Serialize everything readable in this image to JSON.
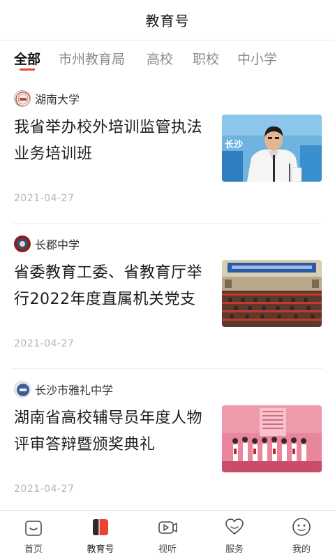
{
  "header": {
    "title": "教育号"
  },
  "tabs": [
    {
      "label": "全部",
      "active": true
    },
    {
      "label": "市州教育局"
    },
    {
      "label": "高校"
    },
    {
      "label": "职校"
    },
    {
      "label": "中小学"
    }
  ],
  "accent_color": "#e8442f",
  "articles": [
    {
      "source": "湖南大学",
      "title": "我省举办校外培训监管执法业务培训班",
      "date": "2021-04-27",
      "avatar_icon": "hunan-university-logo-icon",
      "thumb_text": "长沙"
    },
    {
      "source": "长郡中学",
      "title": "省委教育工委、省教育厅举行2022年度直属机关党支",
      "date": "2021-04-27",
      "avatar_icon": "changjun-school-logo-icon"
    },
    {
      "source": "长沙市雅礼中学",
      "title": "湖南省高校辅导员年度人物评审答辩暨颁奖典礼",
      "date": "2021-04-27",
      "avatar_icon": "yali-school-logo-icon"
    }
  ],
  "bottom_nav": [
    {
      "label": "首页",
      "icon": "home-icon"
    },
    {
      "label": "教育号",
      "icon": "education-book-icon",
      "active": true
    },
    {
      "label": "视听",
      "icon": "video-camera-icon"
    },
    {
      "label": "服务",
      "icon": "heart-icon"
    },
    {
      "label": "我的",
      "icon": "profile-face-icon"
    }
  ]
}
